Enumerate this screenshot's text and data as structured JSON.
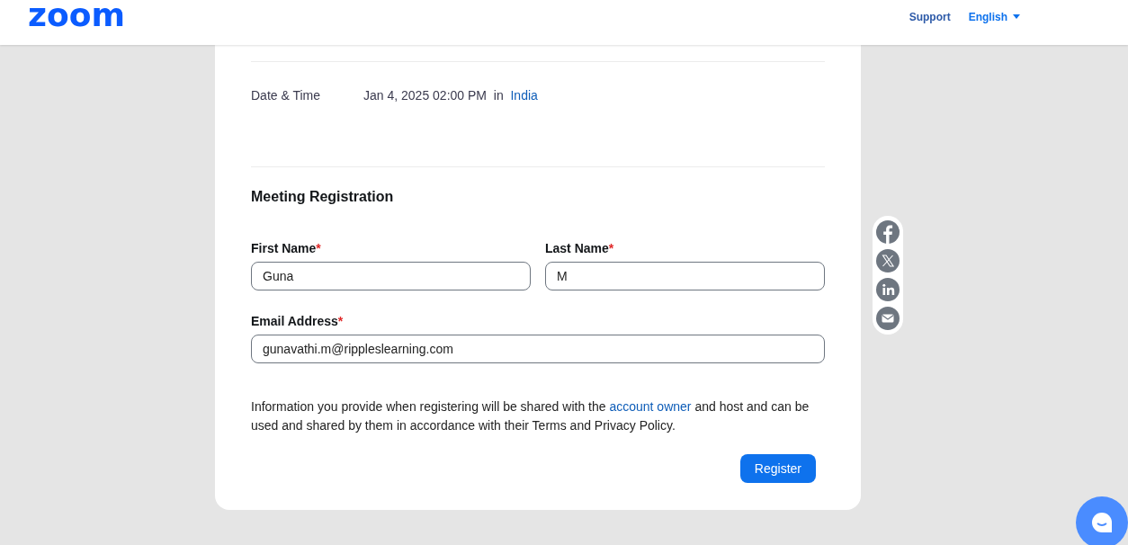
{
  "header": {
    "logo": "zoom",
    "nav": [
      {
        "label": "Support",
        "kind": "link"
      },
      {
        "label": "English",
        "kind": "dropdown"
      }
    ]
  },
  "event": {
    "label": "Date & Time",
    "value": "Jan 4, 2025 02:00 PM",
    "connector": "in",
    "timezone": "India"
  },
  "registration": {
    "title": "Meeting Registration",
    "fields": [
      {
        "label": "First Name",
        "required_mark": "*",
        "value": "Guna",
        "kind": "half"
      },
      {
        "label": "Last Name",
        "required_mark": "*",
        "value": "M",
        "kind": "half"
      },
      {
        "label": "Email Address",
        "required_mark": "*",
        "value": "gunavathi.m@rippleslearning.com",
        "kind": "full"
      }
    ],
    "disclaimer": {
      "before": "Information you provide when registering will be shared with the ",
      "link": "account owner",
      "after": " and host and can be used and shared by them in accordance with their Terms and Privacy Policy."
    },
    "submit": "Register"
  },
  "share": [
    {
      "kind": "facebook"
    },
    {
      "kind": "x"
    },
    {
      "kind": "linkedin"
    },
    {
      "kind": "email"
    }
  ]
}
